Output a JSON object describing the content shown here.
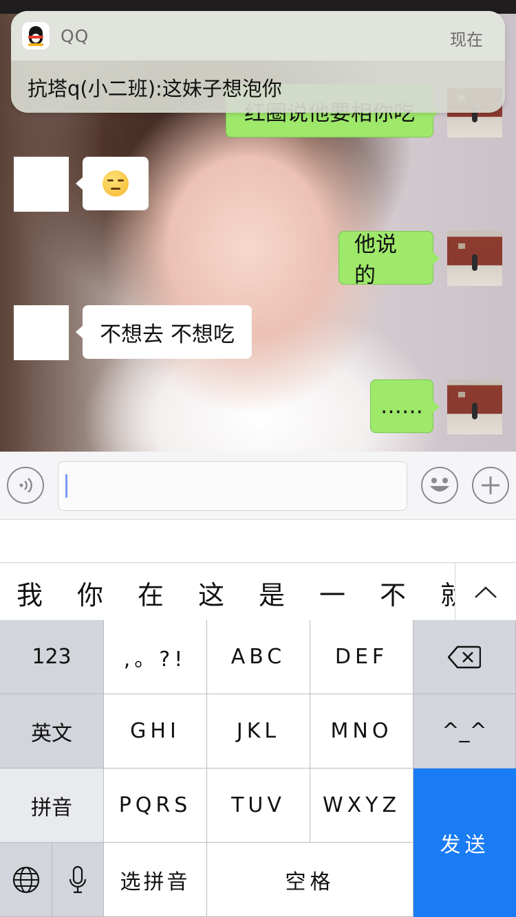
{
  "notification": {
    "app_name": "QQ",
    "time": "现在",
    "message": "抗塔q(小二班):这妹子想泡你"
  },
  "chat": {
    "messages": [
      {
        "side": "right",
        "text": "红圈说他要相你吃"
      },
      {
        "side": "left",
        "text": "",
        "emoji": "unamused-face"
      },
      {
        "side": "right",
        "text": "他说的"
      },
      {
        "side": "left",
        "text": "不想去 不想吃"
      },
      {
        "side": "right",
        "text": "……"
      }
    ]
  },
  "input": {
    "value": "",
    "placeholder": ""
  },
  "candidates": {
    "items": [
      "我",
      "你",
      "在",
      "这",
      "是",
      "一",
      "不",
      "就"
    ]
  },
  "keyboard": {
    "row1": [
      "123",
      ",。?!",
      "ABC",
      "DEF"
    ],
    "row2": [
      "英文",
      "GHI",
      "JKL",
      "MNO",
      "^_^"
    ],
    "row3": [
      "拼音",
      "PQRS",
      "TUV",
      "WXYZ"
    ],
    "row4": [
      "选拼音",
      "空格"
    ],
    "send_label": "发送",
    "accent_color": "#1a7cf5"
  }
}
